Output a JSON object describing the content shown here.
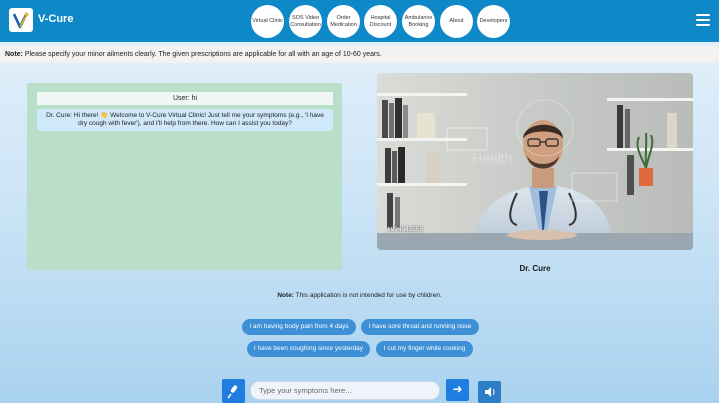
{
  "app": {
    "name": "V-Cure"
  },
  "nav": {
    "items": [
      {
        "label": "Virtual Clinic"
      },
      {
        "label": "SOS Video Consultation"
      },
      {
        "label": "Order Medication"
      },
      {
        "label": "Hospital Discount"
      },
      {
        "label": "Ambulance Booking"
      },
      {
        "label": "About"
      },
      {
        "label": "Developers"
      }
    ]
  },
  "top_note": {
    "prefix": "Note:",
    "text": " Please specify your minor ailments clearly. The given prescriptions are applicable for all with an age of 10-60 years."
  },
  "chat": {
    "user_message": "User: hi",
    "bot_message": "Dr. Cure: Hi there! 👋 Welcome to V-Cure Virtual Clinic! Just tell me your symptoms (e.g., 'I have dry cough with fever'), and I'll help from there. How can I assist you today?"
  },
  "video": {
    "overlay_number": "1994542555"
  },
  "doctor": {
    "name": "Dr. Cure"
  },
  "bottom_note": {
    "prefix": "Note:",
    "text": " This application is not intended for use by children."
  },
  "suggestions": [
    {
      "label": "I am having body pain from 4 days"
    },
    {
      "label": "I have sore throat and running nose"
    },
    {
      "label": "I have been coughing since yesterday"
    },
    {
      "label": "I cut my finger while cooking"
    }
  ],
  "input": {
    "placeholder": "Type your symptoms here...",
    "value": ""
  },
  "icons": {
    "mic": "mic-icon",
    "send": "arrow-right-icon",
    "speaker": "speaker-icon",
    "menu": "hamburger-icon",
    "logo": "v-cure-logo"
  },
  "colors": {
    "header": "#0f88c7",
    "chat_panel": "#b9dec9",
    "chip": "#3d8fd6",
    "button": "#1f7de0"
  }
}
